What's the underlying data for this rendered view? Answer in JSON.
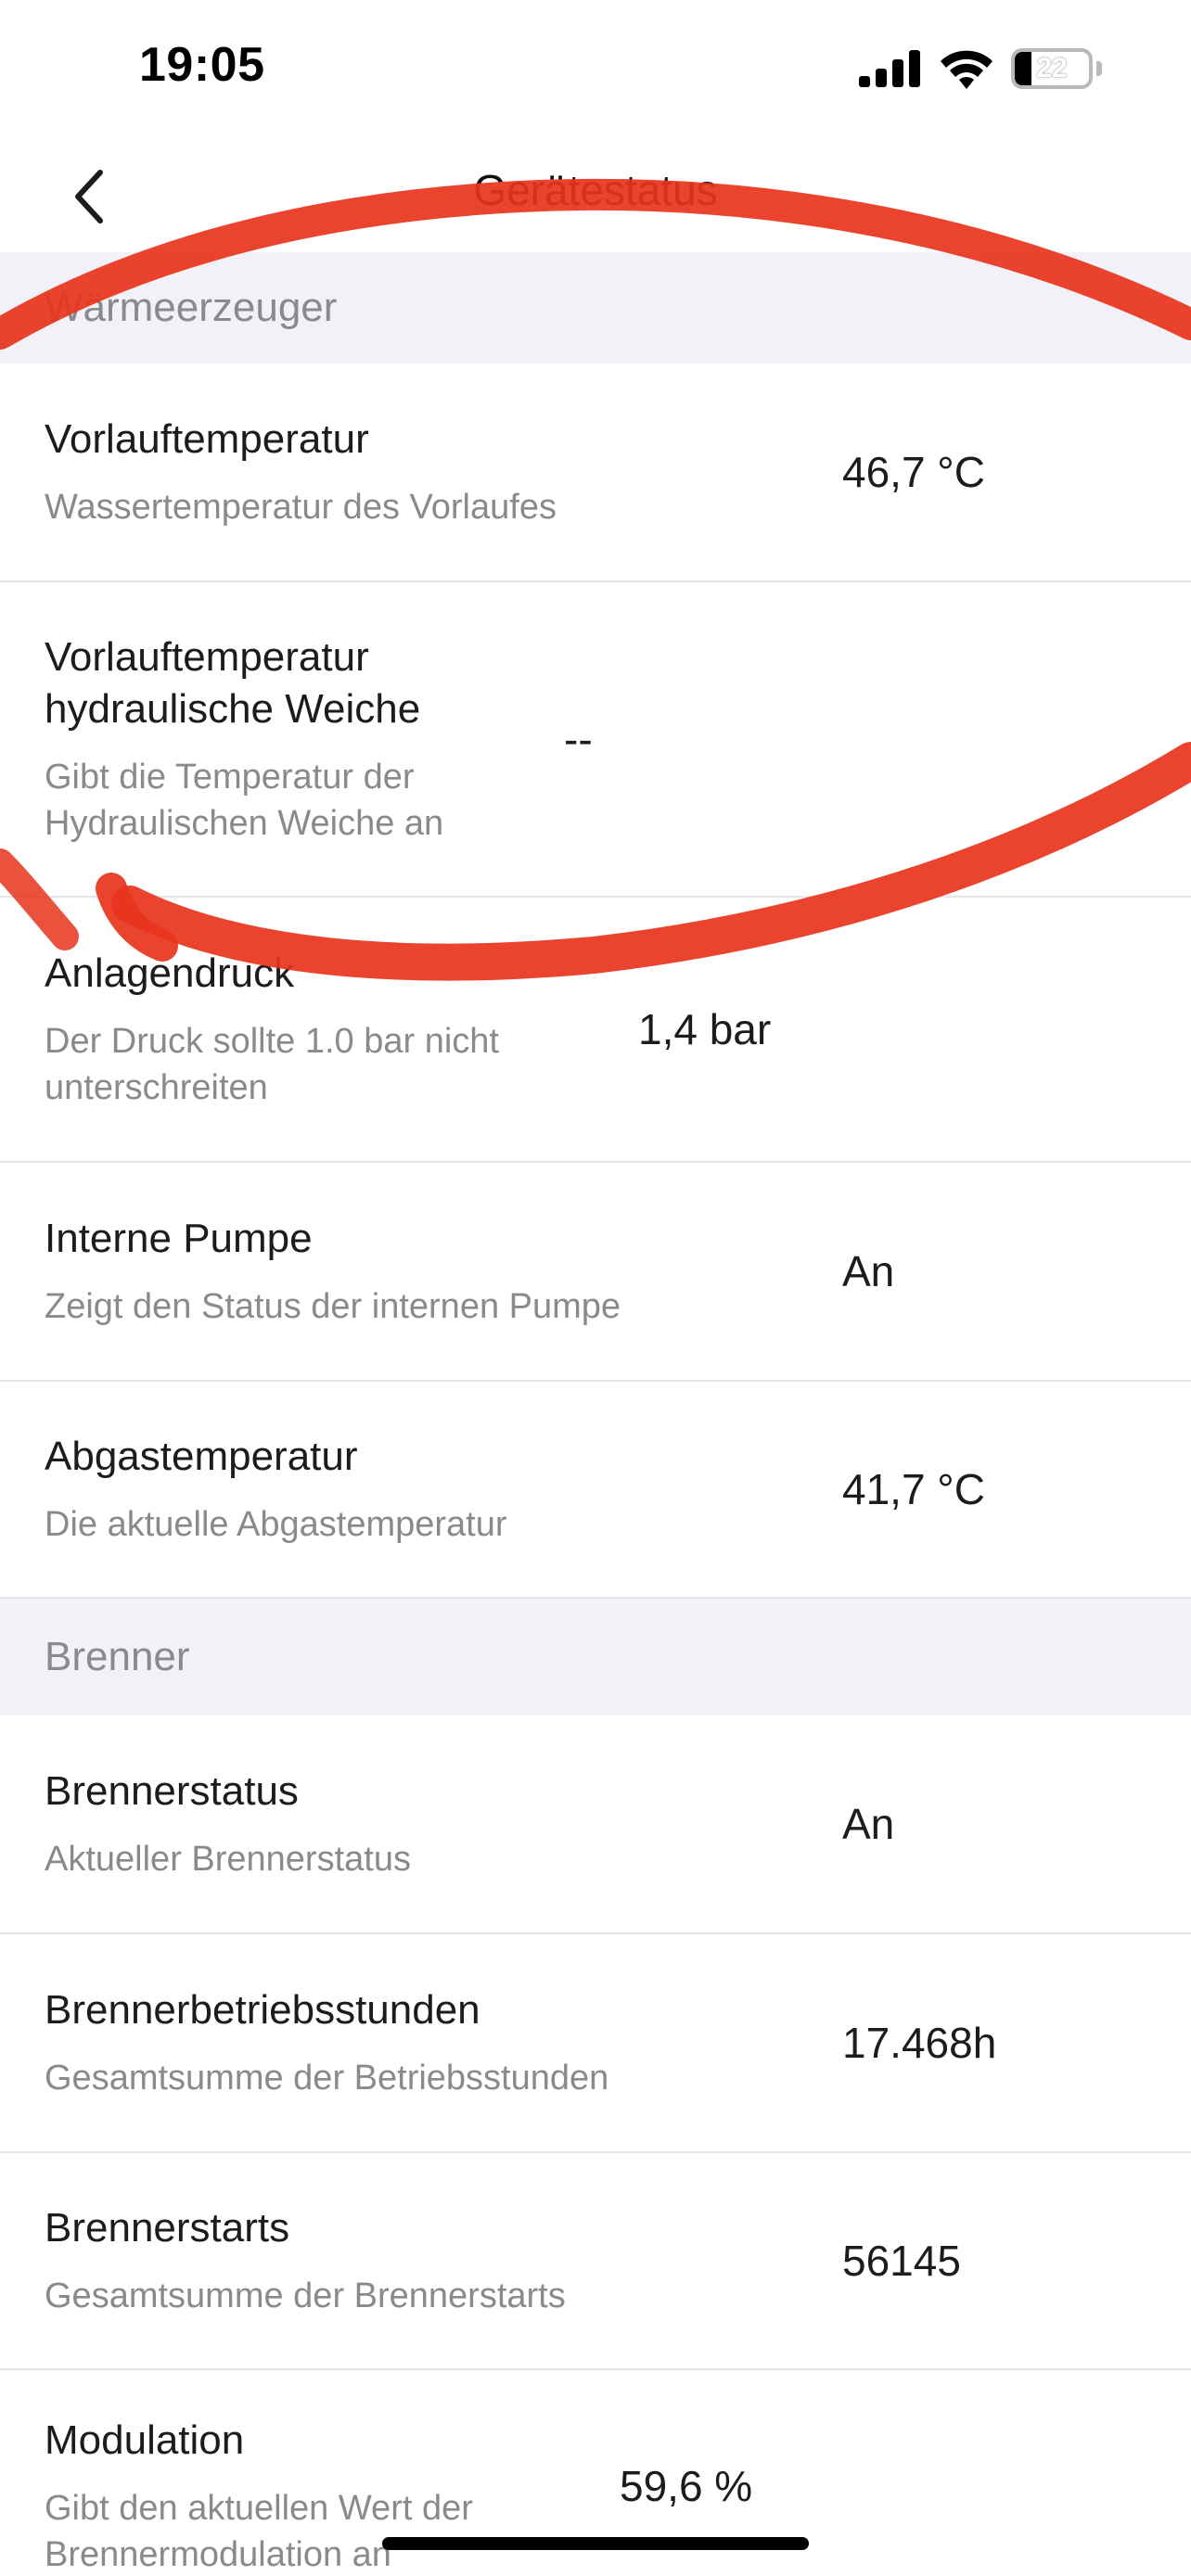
{
  "status_bar": {
    "time": "19:05",
    "battery_level": "22",
    "battery_fraction": 0.22,
    "icons": [
      "cellular-signal-icon",
      "wifi-icon",
      "battery-icon"
    ]
  },
  "nav": {
    "back_icon": "chevron-left-icon",
    "title": "Gerätestatus"
  },
  "sections": [
    {
      "header": "Wärmeerzeuger",
      "rows": [
        {
          "title": "Vorlauftemperatur",
          "subtitle": "Wassertemperatur des Vorlaufes",
          "value": "46,7 °C"
        },
        {
          "title": "Vorlauftemperatur hydraulische Weiche",
          "subtitle": "Gibt die Temperatur der Hydraulischen Weiche an",
          "value": "--"
        },
        {
          "title": "Anlagendruck",
          "subtitle": "Der Druck sollte 1.0 bar nicht unterschreiten",
          "value": "1,4 bar"
        },
        {
          "title": "Interne Pumpe",
          "subtitle": "Zeigt den Status der internen Pumpe",
          "value": "An"
        },
        {
          "title": "Abgastemperatur",
          "subtitle": "Die aktuelle Abgastemperatur",
          "value": "41,7 °C"
        }
      ]
    },
    {
      "header": "Brenner",
      "rows": [
        {
          "title": "Brennerstatus",
          "subtitle": "Aktueller Brennerstatus",
          "value": "An"
        },
        {
          "title": "Brennerbetriebsstunden",
          "subtitle": "Gesamtsumme der Betriebsstunden",
          "value": "17.468h"
        },
        {
          "title": "Brennerstarts",
          "subtitle": "Gesamtsumme der Brennerstarts",
          "value": "56145"
        },
        {
          "title": "Modulation",
          "subtitle": "Gibt den aktuellen Wert der Brennermodulation an",
          "value": "59,6 %"
        }
      ]
    }
  ],
  "colors": {
    "section_header_bg": "#f2f1f7",
    "annotation_red": "#e8341c",
    "secondary_text": "#8a8a8e"
  }
}
